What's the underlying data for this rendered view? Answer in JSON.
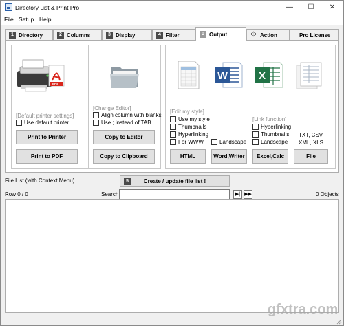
{
  "window": {
    "title": "Directory List & Print Pro",
    "controls": {
      "minimize": "—",
      "maximize": "☐",
      "close": "✕"
    }
  },
  "menu": [
    "File",
    "Setup",
    "Help"
  ],
  "tabs": [
    {
      "num": "1",
      "label": "Directory"
    },
    {
      "num": "2",
      "label": "Columns"
    },
    {
      "num": "3",
      "label": "Display"
    },
    {
      "num": "4",
      "label": "Filter"
    },
    {
      "num": "0",
      "label": "Output",
      "active": true
    },
    {
      "icon": "gear-icon",
      "label": "Action"
    },
    {
      "label": "Pro License"
    }
  ],
  "printer_panel": {
    "hint": "[Default printer settings]",
    "use_default_printer": {
      "label": "Use default printer",
      "checked": false
    },
    "print_to_printer": "Print to Printer",
    "print_to_pdf": "Print to PDF",
    "icon": "printer-pdf-icon"
  },
  "editor_panel": {
    "hint": "[Change Editor]",
    "align_blanks": {
      "label": "Align column with blanks",
      "checked": false
    },
    "use_semicolon": {
      "label": "Use  ;  instead of TAB",
      "checked": false
    },
    "copy_to_editor": "Copy to Editor",
    "copy_to_clipboard": "Copy to Clipboard",
    "icon": "folder-icon"
  },
  "export_panel": {
    "style_hint": "[Edit my style]",
    "link_hint": "[Link function]",
    "html_options": [
      {
        "label": "Use my style",
        "checked": false
      },
      {
        "label": "Thumbnails",
        "checked": false
      },
      {
        "label": "Hyperlinking",
        "checked": false
      },
      {
        "label": "For WWW",
        "checked": false
      }
    ],
    "word_landscape": {
      "label": "Landscape",
      "checked": false
    },
    "excel_options": [
      {
        "label": "Hyperlinking",
        "checked": false
      },
      {
        "label": "Thumbnails",
        "checked": false
      },
      {
        "label": "Landscape",
        "checked": false
      }
    ],
    "file_formats": [
      "TXT, CSV",
      "XML, XLS"
    ],
    "buttons": {
      "html": "HTML",
      "word": "Word,Writer",
      "excel": "Excel,Calc",
      "file": "File"
    },
    "icons": [
      "html-document-icon",
      "word-document-icon",
      "excel-document-icon",
      "text-file-icon"
    ]
  },
  "list_area": {
    "label": "File List (with Context Menu)",
    "create_button": {
      "num": "5",
      "label": "Create / update file list !"
    },
    "row_status": "Row 0 / 0",
    "search_label": "Search",
    "search_value": "",
    "object_count": "0 Objects",
    "nav": {
      "next": "▶|",
      "last": "▶▶"
    }
  },
  "watermark": "gfxtra.com",
  "colors": {
    "window_bg": "#f0f0f0",
    "button_bg": "#e1e1e1",
    "tab_num_bg": "#4a4a4a",
    "word_blue": "#2b5797",
    "excel_green": "#217346",
    "pdf_red": "#d9261c"
  }
}
